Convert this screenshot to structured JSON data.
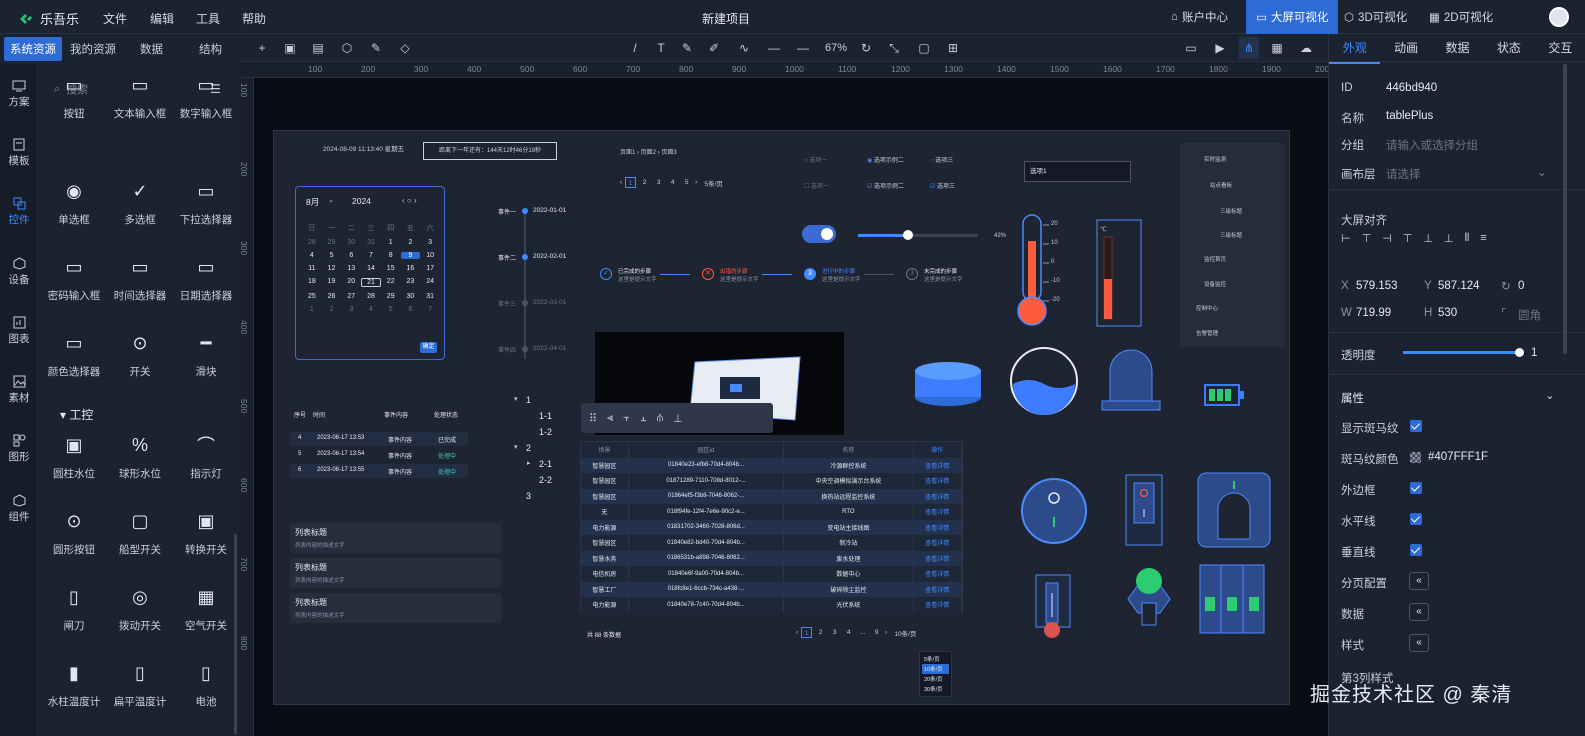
{
  "app": {
    "name": "乐吾乐",
    "project_title": "新建项目",
    "menu": [
      "文件",
      "编辑",
      "工具",
      "帮助"
    ],
    "nav": [
      {
        "label": "账户中心"
      },
      {
        "label": "大屏可视化"
      },
      {
        "label": "3D可视化"
      },
      {
        "label": "2D可视化"
      }
    ]
  },
  "left": {
    "tabs": [
      "系统资源",
      "我的资源",
      "数据",
      "结构"
    ],
    "rail": [
      "方案",
      "模板",
      "控件",
      "设备",
      "图表",
      "素材",
      "图形",
      "组件"
    ],
    "search_placeholder": "搜索",
    "components": [
      "按钮",
      "文本输入框",
      "数字输入框",
      "单选框",
      "多选框",
      "下拉选择器",
      "密码输入框",
      "时间选择器",
      "日期选择器",
      "颜色选择器",
      "开关",
      "滑块"
    ],
    "section": "工控",
    "industrial": [
      "圆柱水位",
      "球形水位",
      "指示灯",
      "圆形按钮",
      "船型开关",
      "转换开关",
      "闸刀",
      "拨动开关",
      "空气开关",
      "水柱温度计",
      "扁平温度计",
      "电池"
    ]
  },
  "toolbar": {
    "zoom": "67%"
  },
  "ruler": {
    "h": [
      "100",
      "200",
      "300",
      "400",
      "500",
      "600",
      "700",
      "800",
      "900",
      "1000",
      "1100",
      "1200",
      "1300",
      "1400",
      "1500",
      "1600",
      "1700",
      "1800",
      "1900",
      "2000"
    ],
    "v": [
      "100",
      "200",
      "300",
      "400",
      "500",
      "600",
      "700",
      "800"
    ]
  },
  "stage": {
    "datetime": "2024-08-09 11:13:40 星期五",
    "countdown": "距离下一年还有：144天12时46分19秒",
    "breadcrumb": "页面1 › 页面2 › 页面3",
    "cal": {
      "month": "8月",
      "year": "2024",
      "week": [
        "日",
        "一",
        "二",
        "三",
        "四",
        "五",
        "六"
      ],
      "days": [
        "28",
        "29",
        "30",
        "31",
        "1",
        "2",
        "3",
        "4",
        "5",
        "6",
        "7",
        "8",
        "9",
        "10",
        "11",
        "12",
        "13",
        "14",
        "15",
        "16",
        "17",
        "18",
        "19",
        "20",
        "21",
        "22",
        "23",
        "24",
        "25",
        "26",
        "27",
        "28",
        "29",
        "30",
        "31",
        "1",
        "2",
        "3",
        "4",
        "5",
        "6",
        "7"
      ],
      "ok": "确定"
    },
    "pager1": [
      "1",
      "2",
      "3",
      "4",
      "5"
    ],
    "pager1_size": "5条/页",
    "radios": [
      "选项一",
      "选项示例二",
      "选项三"
    ],
    "checks": [
      "选项一",
      "选项示例二",
      "选项三"
    ],
    "select_value": "选项1",
    "slider_pct": "42%",
    "timeline": [
      {
        "title": "事件一",
        "date": "2022-01-01"
      },
      {
        "title": "事件二",
        "date": "2022-02-01"
      },
      {
        "title": "事件三",
        "date": "2022-03-01"
      },
      {
        "title": "事件四",
        "date": "2022-04-01"
      }
    ],
    "steps": [
      {
        "t": "已完成的步骤",
        "d": "这里是提示文字"
      },
      {
        "t": "出错的步骤",
        "d": "这里是提示文字"
      },
      {
        "t": "进行中的步骤",
        "d": "这里是提示文字"
      },
      {
        "t": "未完成的步骤",
        "d": "这里是提示文字"
      }
    ],
    "tree_menu": [
      "实时监测",
      "站点看板",
      "三级标题",
      "三级标题",
      "监控首页",
      "设备监控",
      "控制中心",
      "告警管理"
    ],
    "therm_ticks": [
      "20",
      "10",
      "0",
      "-10",
      "-20"
    ],
    "event_table": {
      "headers": [
        "序号",
        "时间",
        "事件内容",
        "处理状态"
      ],
      "rows": [
        [
          "4",
          "2023-06-17 13:53",
          "事件内容",
          "已完成"
        ],
        [
          "5",
          "2023-06-17 13:54",
          "事件内容",
          "处理中"
        ],
        [
          "6",
          "2023-06-17 13:55",
          "事件内容",
          "处理中"
        ]
      ]
    },
    "tree": [
      "1",
      "1-1",
      "1-2",
      "2",
      "2-1",
      "2-2",
      "3"
    ],
    "lists": [
      {
        "t": "列表标题",
        "d": "列表内容的描述文字"
      },
      {
        "t": "列表标题",
        "d": "列表内容的描述文字"
      },
      {
        "t": "列表标题",
        "d": "列表内容的描述文字"
      }
    ],
    "big_table": {
      "headers": [
        "场景",
        "园区id",
        "名称",
        "操作"
      ],
      "rows": [
        [
          "智慧园区",
          "01840e23-efb8-70d4-804b...",
          "冷源群控系统",
          "查看详情"
        ],
        [
          "智慧园区",
          "01871289-7110-708d-8012-...",
          "中央空调模拟演示台系统",
          "查看详情"
        ],
        [
          "智慧园区",
          "01864ef5-f3b8-7046-8062-...",
          "换热站远程监控系统",
          "查看详情"
        ],
        [
          "无",
          "018f94fe-12f4-7e6e-90c2-e...",
          "RTO",
          "查看详情"
        ],
        [
          "电力能源",
          "01831702-3460-7028-806d...",
          "变电站主接线图",
          "查看详情"
        ],
        [
          "智慧园区",
          "01840e82-bd40-70d4-804b...",
          "制冷站",
          "查看详情"
        ],
        [
          "智慧水务",
          "0186531b-a898-7046-8062...",
          "废水处理",
          "查看详情"
        ],
        [
          "电信机房",
          "01840e6f-9a00-70d4-804b...",
          "数据中心",
          "查看详情"
        ],
        [
          "智慧工厂",
          "018fc8e1-6ccb-734c-a438-...",
          "破碎除尘监控",
          "查看详情"
        ],
        [
          "电力能源",
          "01840e78-7c40-70d4-804b...",
          "光伏系统",
          "查看详情"
        ]
      ],
      "total": "共 88 条数据",
      "pages": [
        "1",
        "2",
        "3",
        "4",
        "...",
        "9"
      ],
      "page_size": "10条/页",
      "sizes": [
        "5条/页",
        "10条/页",
        "20条/页",
        "30条/页"
      ]
    }
  },
  "right": {
    "tabs": [
      "外观",
      "动画",
      "数据",
      "状态",
      "交互"
    ],
    "id_label": "ID",
    "id": "446bd940",
    "name_label": "名称",
    "name": "tablePlus",
    "group_label": "分组",
    "group_ph": "请输入或选择分组",
    "layer_label": "画布层",
    "layer_ph": "请选择",
    "align_label": "大屏对齐",
    "x_label": "X",
    "x": "579.153",
    "y_label": "Y",
    "y": "587.124",
    "rot": "0",
    "w_label": "W",
    "w": "719.99",
    "h_label": "H",
    "h": "530",
    "radius_ph": "圆角",
    "opacity_label": "透明度",
    "opacity": "1",
    "props_label": "属性",
    "props": [
      {
        "l": "显示斑马纹",
        "type": "check"
      },
      {
        "l": "斑马纹颜色",
        "type": "color",
        "v": "#407FFF1F"
      },
      {
        "l": "外边框",
        "type": "check"
      },
      {
        "l": "水平线",
        "type": "check"
      },
      {
        "l": "垂直线",
        "type": "check"
      },
      {
        "l": "分页配置",
        "type": "btn"
      },
      {
        "l": "数据",
        "type": "btn"
      },
      {
        "l": "样式",
        "type": "btn"
      }
    ],
    "col3": "第3列样式"
  },
  "watermark": "掘金技术社区 @ 秦清",
  "colors": {
    "accent": "#2d6bd6",
    "bg": "#1b2230",
    "stage": "#1e2431"
  }
}
